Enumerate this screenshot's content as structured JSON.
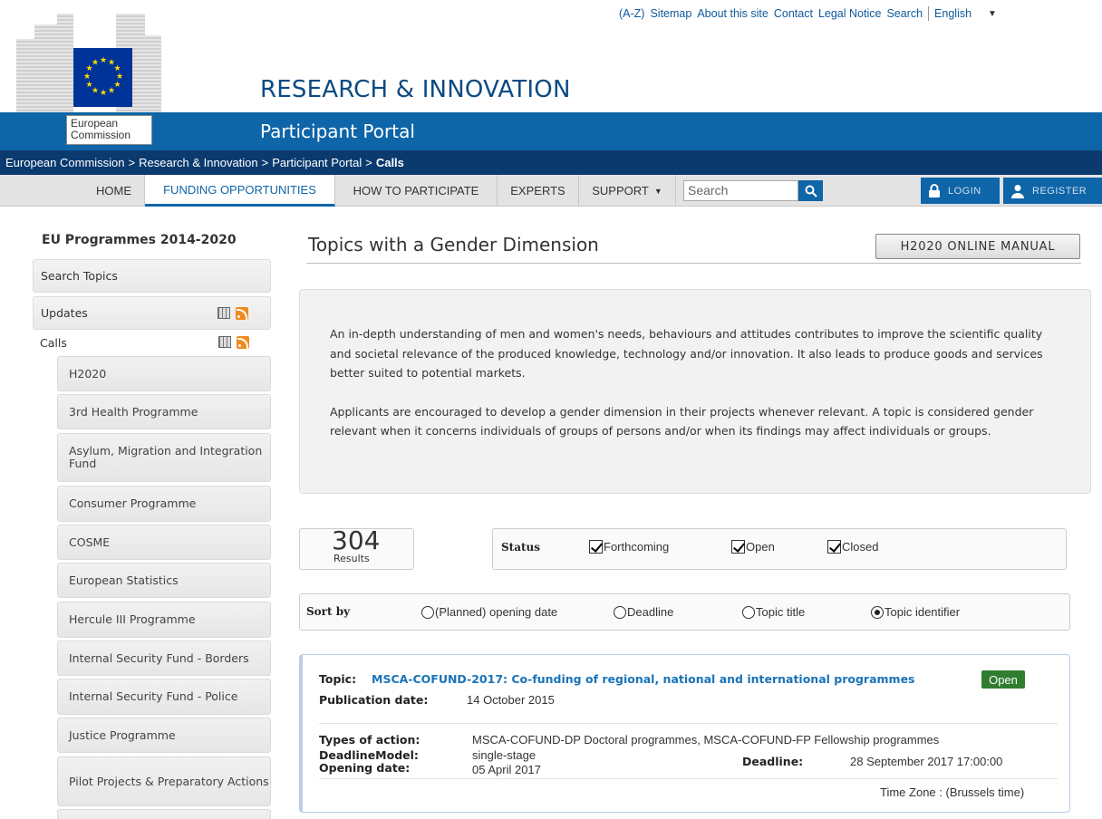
{
  "top_links": [
    "(A-Z)",
    "Sitemap",
    "About this site",
    "Contact",
    "Legal Notice",
    "Search"
  ],
  "language": "English",
  "logo": {
    "label": "European Commission"
  },
  "header": {
    "site_title": "RESEARCH & INNOVATION",
    "portal_title": "Participant Portal"
  },
  "breadcrumb": [
    "European Commission",
    "Research & Innovation",
    "Participant Portal",
    "Calls"
  ],
  "nav": {
    "items": [
      "HOME",
      "FUNDING OPPORTUNITIES",
      "HOW TO PARTICIPATE",
      "EXPERTS",
      "SUPPORT"
    ],
    "active": "FUNDING OPPORTUNITIES",
    "search_placeholder": "Search",
    "login": "LOGIN",
    "register": "REGISTER"
  },
  "sidebar": {
    "title": "EU Programmes 2014-2020",
    "top_items": [
      "Search Topics",
      "Updates",
      "Calls"
    ],
    "sub_items": [
      "H2020",
      "3rd Health Programme",
      "Asylum, Migration and Integration Fund",
      "Consumer Programme",
      "COSME",
      "European Statistics",
      "Hercule III Programme",
      "Internal Security Fund - Borders",
      "Internal Security Fund - Police",
      "Justice Programme",
      "Pilot Projects & Preparatory Actions"
    ]
  },
  "main": {
    "title": "Topics with a Gender Dimension",
    "manual_button": "H2020 ONLINE MANUAL",
    "intro": [
      "An in-depth understanding of men and women's needs, behaviours and attitudes contributes to improve the scientific quality and societal relevance of the produced knowledge, technology and/or innovation. It also leads to produce goods and services better suited to potential markets.",
      "Applicants are encouraged to develop a gender dimension in their projects whenever relevant. A topic is considered gender relevant when it concerns individuals of groups of persons and/or when its findings may affect individuals or groups."
    ],
    "results_count": "304",
    "results_label": "Results",
    "status": {
      "label": "Status",
      "options": [
        {
          "label": "Forthcoming",
          "checked": true
        },
        {
          "label": "Open",
          "checked": true
        },
        {
          "label": "Closed",
          "checked": true
        }
      ]
    },
    "sort": {
      "label": "Sort by",
      "options": [
        {
          "label": "(Planned) opening date",
          "selected": false
        },
        {
          "label": "Deadline",
          "selected": false
        },
        {
          "label": "Topic title",
          "selected": false
        },
        {
          "label": "Topic identifier",
          "selected": true
        }
      ]
    },
    "topic": {
      "topic_label": "Topic:",
      "topic_title": "MSCA-COFUND-2017: Co-funding of regional, national and international programmes",
      "status_badge": "Open",
      "publication_date_label": "Publication date:",
      "publication_date": "14 October 2015",
      "types_label": "Types of action:",
      "types": "MSCA-COFUND-DP Doctoral programmes, MSCA-COFUND-FP Fellowship programmes",
      "deadline_model_label": "DeadlineModel:",
      "deadline_model": "single-stage",
      "opening_date_label": "Opening date:",
      "opening_date": "05 April 2017",
      "deadline_label": "Deadline:",
      "deadline": "28 September 2017 17:00:00",
      "time_zone": "Time Zone : (Brussels time)"
    }
  },
  "colors": {
    "brand_blue": "#0e65a8",
    "dark_blue": "#0b3a6f",
    "link_blue": "#1a73b8",
    "open_green": "#2f7d2f",
    "rss_orange": "#f08a1f"
  }
}
